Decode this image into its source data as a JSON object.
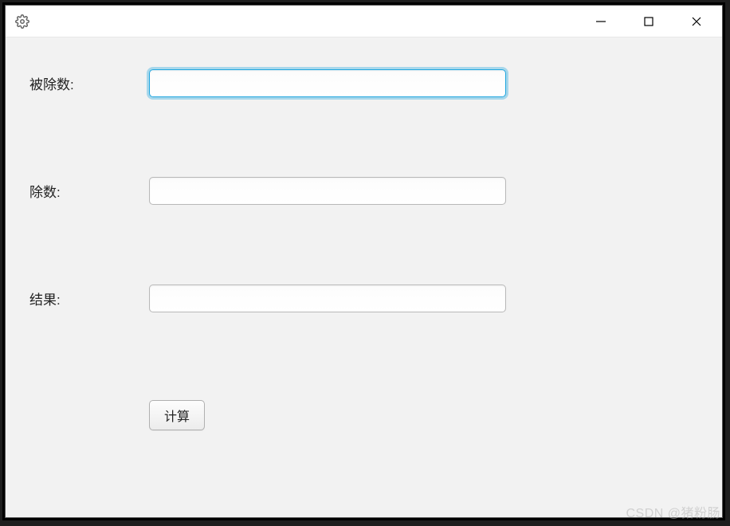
{
  "titlebar": {
    "icon_name": "gear-icon"
  },
  "form": {
    "dividend_label": "被除数:",
    "divisor_label": "除数:",
    "result_label": "结果:",
    "dividend_value": "",
    "divisor_value": "",
    "result_value": "",
    "calculate_label": "计算"
  },
  "watermark": "CSDN @猪粉肠"
}
